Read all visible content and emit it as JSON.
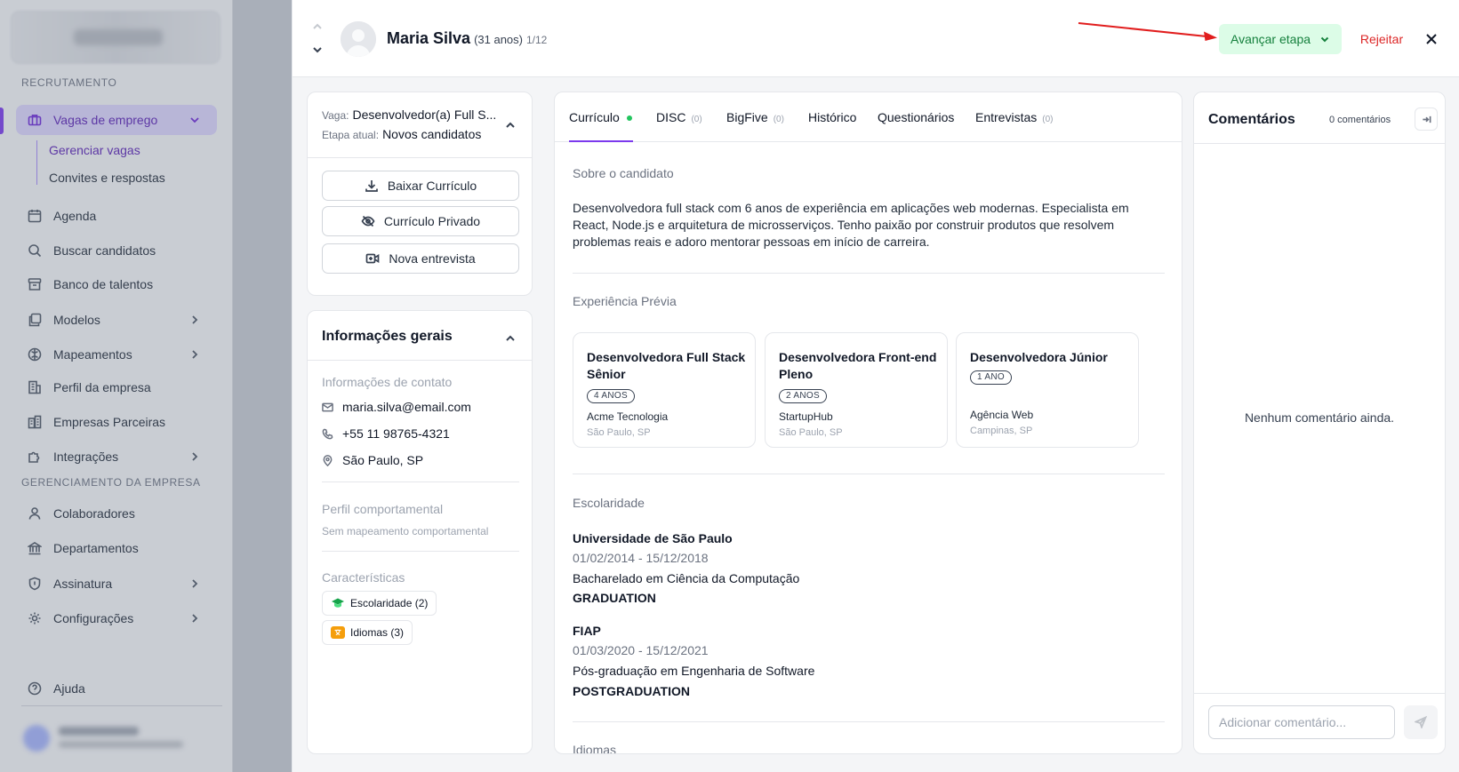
{
  "sidebar": {
    "section_recruitment": "RECRUTAMENTO",
    "section_company": "GERENCIAMENTO DA EMPRESA",
    "items": {
      "vagas": "Vagas de emprego",
      "gerenciar": "Gerenciar vagas",
      "convites": "Convites e respostas",
      "agenda": "Agenda",
      "buscar": "Buscar candidatos",
      "banco": "Banco de talentos",
      "modelos": "Modelos",
      "mapeamentos": "Mapeamentos",
      "perfil": "Perfil da empresa",
      "parceiras": "Empresas Parceiras",
      "integracoes": "Integrações",
      "colaboradores": "Colaboradores",
      "departamentos": "Departamentos",
      "assinatura": "Assinatura",
      "configuracoes": "Configurações",
      "ajuda": "Ajuda"
    }
  },
  "candidate": {
    "name": "Maria Silva",
    "age": "(31 anos)",
    "position": "1/12"
  },
  "actions": {
    "advance": "Avançar etapa",
    "reject": "Rejeitar"
  },
  "job": {
    "vaga_label": "Vaga:",
    "vaga_value": "Desenvolvedor(a) Full S...",
    "etapa_label": "Etapa atual:",
    "etapa_value": "Novos candidatos",
    "download_cv": "Baixar Currículo",
    "private_cv": "Currículo Privado",
    "new_interview": "Nova entrevista"
  },
  "info": {
    "title": "Informações gerais",
    "contact_title": "Informações de contato",
    "email": "maria.silva@email.com",
    "phone": "+55 11 98765-4321",
    "location": "São Paulo, SP",
    "behavior_title": "Perfil comportamental",
    "behavior_value": "Sem mapeamento comportamental",
    "traits_title": "Características",
    "chip_education": "Escolaridade (2)",
    "chip_languages": "Idiomas (3)"
  },
  "tabs": [
    {
      "label": "Currículo",
      "count": ""
    },
    {
      "label": "DISC",
      "count": "(0)"
    },
    {
      "label": "BigFive",
      "count": "(0)"
    },
    {
      "label": "Histórico",
      "count": ""
    },
    {
      "label": "Questionários",
      "count": ""
    },
    {
      "label": "Entrevistas",
      "count": "(0)"
    }
  ],
  "cv": {
    "about_title": "Sobre o candidato",
    "about_text": "Desenvolvedora full stack com 6 anos de experiência em aplicações web modernas. Especialista em React, Node.js e arquitetura de microsserviços. Tenho paixão por construir produtos que resolvem problemas reais e adoro mentorar pessoas em início de carreira.",
    "experience_title": "Experiência Prévia",
    "experiences": [
      {
        "title": "Desenvolvedora Full Stack Sênior",
        "duration": "4 ANOS",
        "company": "Acme Tecnologia",
        "location": "São Paulo, SP"
      },
      {
        "title": "Desenvolvedora Front-end Pleno",
        "duration": "2 ANOS",
        "company": "StartupHub",
        "location": "São Paulo, SP"
      },
      {
        "title": "Desenvolvedora Júnior",
        "duration": "1 ANO",
        "company": "Agência Web",
        "location": "Campinas, SP"
      }
    ],
    "education_title": "Escolaridade",
    "education": [
      {
        "institution": "Universidade de São Paulo",
        "dates": "01/02/2014 - 15/12/2018",
        "course": "Bacharelado em Ciência da Computação",
        "level": "GRADUATION"
      },
      {
        "institution": "FIAP",
        "dates": "01/03/2020 - 15/12/2021",
        "course": "Pós-graduação em Engenharia de Software",
        "level": "POSTGRADUATION"
      }
    ],
    "languages_title": "Idiomas"
  },
  "comments": {
    "title": "Comentários",
    "count": "0 comentários",
    "empty": "Nenhum comentário ainda.",
    "placeholder": "Adicionar comentário..."
  },
  "colors": {
    "accent": "#7c3aed",
    "advance_bg": "#dcfce7",
    "advance_text": "#15803d",
    "reject_text": "#dc2626",
    "annotation_arrow": "#e11d1d"
  }
}
